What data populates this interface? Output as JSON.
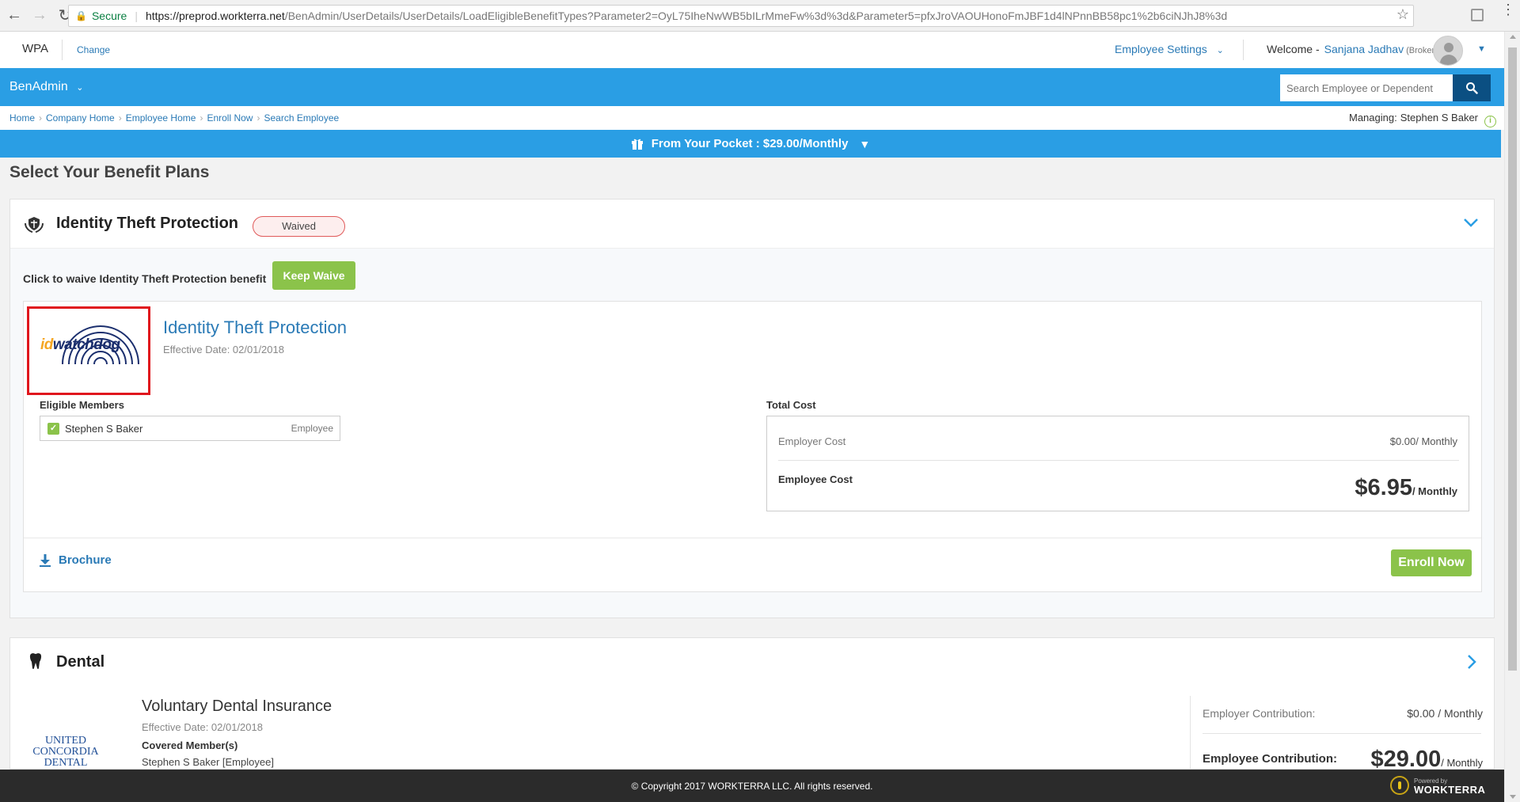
{
  "browser": {
    "secure_label": "Secure",
    "url_host": "https://preprod.workterra.net",
    "url_path": "/BenAdmin/UserDetails/UserDetails/LoadEligibleBenefitTypes?Parameter2=OyL75IheNwWB5bILrMmeFw%3d%3d&Parameter5=pfxJroVAOUHonoFmJBF1d4lNPnnBB58pc1%2b6ciNJhJ8%3d"
  },
  "header": {
    "app_name": "WPA",
    "change_link": "Change",
    "settings_label": "Employee Settings",
    "welcome_label": "Welcome -",
    "user_name": "Sanjana Jadhav",
    "user_role": "(Broker)"
  },
  "nav": {
    "menu_label": "BenAdmin",
    "search_placeholder": "Search Employee or Dependent"
  },
  "breadcrumb": {
    "items": [
      "Home",
      "Company Home",
      "Employee Home",
      "Enroll Now",
      "Search Employee"
    ]
  },
  "managing": {
    "label": "Managing:",
    "name": "Stephen S Baker"
  },
  "pocket": {
    "label": "From Your Pocket : $29.00/Monthly"
  },
  "page": {
    "title": "Select Your Benefit Plans"
  },
  "itp": {
    "title": "Identity Theft Protection",
    "status": "Waived",
    "waive_text": "Click to waive Identity Theft Protection benefit",
    "keep_waive_label": "Keep Waive",
    "logo_id": "id",
    "logo_brand": "watchdog",
    "plan_name": "Identity Theft Protection",
    "effective_date": "Effective Date: 02/01/2018",
    "eligible_label": "Eligible Members",
    "member_name": "Stephen S Baker",
    "member_type": "Employee",
    "total_cost_label": "Total Cost",
    "employer_cost_label": "Employer Cost",
    "employer_cost_value": "$0.00/ Monthly",
    "employee_cost_label": "Employee Cost",
    "employee_cost_amount": "$6.95",
    "employee_cost_period": "/ Monthly",
    "brochure_label": "Brochure",
    "enroll_label": "Enroll Now"
  },
  "dental": {
    "title": "Dental",
    "logo_line1": "UNITED CONCORDIA",
    "logo_line2": "DENTAL",
    "plan_name": "Voluntary Dental Insurance",
    "effective_date": "Effective Date: 02/01/2018",
    "covered_label": "Covered Member(s)",
    "covered_member": "Stephen S Baker [Employee]",
    "employer_contrib_label": "Employer Contribution:",
    "employer_contrib_value": "$0.00 / Monthly",
    "employee_contrib_label": "Employee Contribution:",
    "employee_contrib_amount": "$29.00",
    "employee_contrib_period": "/ Monthly"
  },
  "footer": {
    "copyright": "© Copyright 2017 WORKTERRA LLC. All rights reserved.",
    "powered_by": "Powered by",
    "brand": "WORKTERRA"
  },
  "colors": {
    "primary_blue": "#2a9ee4",
    "link_blue": "#2a7ab6",
    "green": "#8bc34a",
    "waived_red": "#e05a5a",
    "footer_dark": "#2b2b2b"
  }
}
